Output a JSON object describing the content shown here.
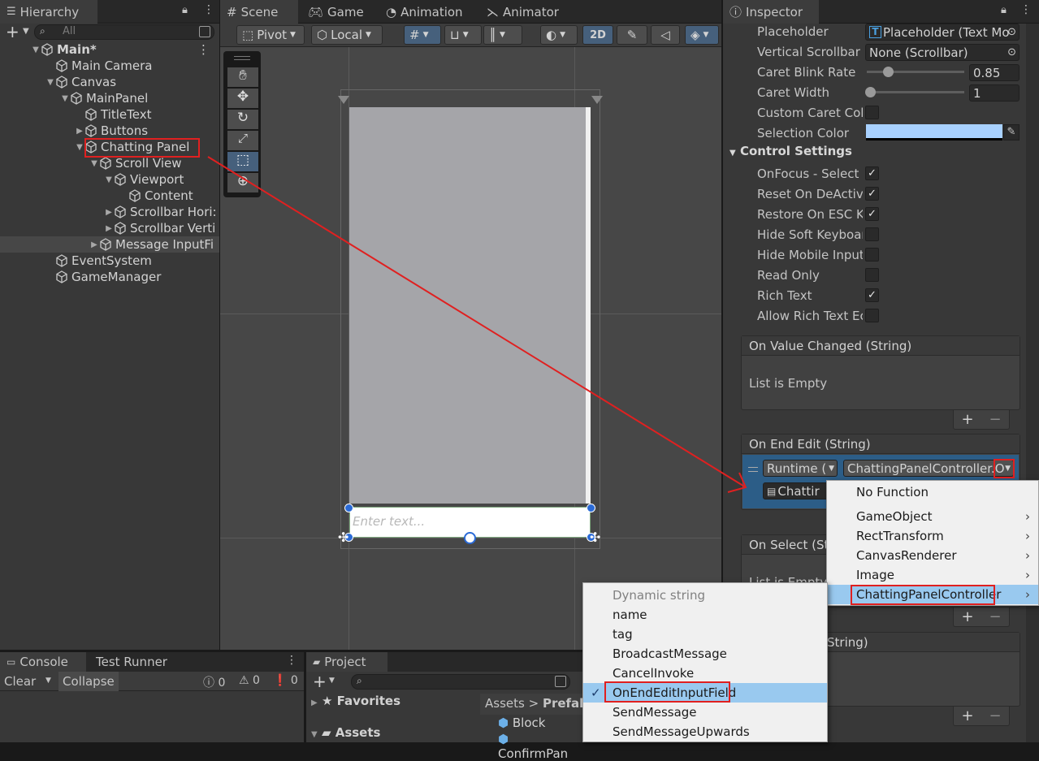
{
  "hierarchy": {
    "tab": "Hierarchy",
    "search_placeholder": "All",
    "items": [
      {
        "label": "Main*",
        "depth": 0,
        "expanded": true,
        "bold": true
      },
      {
        "label": "Main Camera",
        "depth": 1
      },
      {
        "label": "Canvas",
        "depth": 1,
        "expanded": true
      },
      {
        "label": "MainPanel",
        "depth": 2,
        "expanded": true
      },
      {
        "label": "TitleText",
        "depth": 3
      },
      {
        "label": "Buttons",
        "depth": 3,
        "collapsed": true
      },
      {
        "label": "Chatting Panel",
        "depth": 3,
        "expanded": true,
        "highlighted": true
      },
      {
        "label": "Scroll View",
        "depth": 4,
        "expanded": true
      },
      {
        "label": "Viewport",
        "depth": 5,
        "expanded": true
      },
      {
        "label": "Content",
        "depth": 6
      },
      {
        "label": "Scrollbar Hori:",
        "depth": 5,
        "collapsed": true
      },
      {
        "label": "Scrollbar Verti",
        "depth": 5,
        "collapsed": true
      },
      {
        "label": "Message InputFi",
        "depth": 4,
        "collapsed": true,
        "selected": true
      },
      {
        "label": "EventSystem",
        "depth": 1
      },
      {
        "label": "GameManager",
        "depth": 1
      }
    ]
  },
  "scene": {
    "tabs": [
      "Scene",
      "Game",
      "Animation",
      "Animator"
    ],
    "pivot": "Pivot",
    "local": "Local",
    "mode2d": "2D",
    "input_placeholder": "Enter text..."
  },
  "inspector": {
    "tab": "Inspector",
    "placeholder_label": "Placeholder",
    "placeholder_value": "Placeholder (Text Mo",
    "vscroll_label": "Vertical Scrollbar",
    "vscroll_value": "None (Scrollbar)",
    "caret_blink_label": "Caret Blink Rate",
    "caret_blink_value": "0.85",
    "caret_blink_fraction": 0.21,
    "caret_width_label": "Caret Width",
    "caret_width_value": "1",
    "caret_width_fraction": 0.0,
    "custom_caret_label": "Custom Caret Colo",
    "selection_color_label": "Selection Color",
    "selection_color": "#a8d1ff",
    "control_settings": "Control Settings",
    "toggles": [
      {
        "label": "OnFocus - Select",
        "checked": true
      },
      {
        "label": "Reset On DeActiva",
        "checked": true
      },
      {
        "label": "Restore On ESC Ke",
        "checked": true
      },
      {
        "label": "Hide Soft Keyboar",
        "checked": false
      },
      {
        "label": "Hide Mobile Input",
        "checked": false
      },
      {
        "label": "Read Only",
        "checked": false
      },
      {
        "label": "Rich Text",
        "checked": true
      },
      {
        "label": "Allow Rich Text Ec",
        "checked": false
      }
    ],
    "on_value_changed": "On Value Changed (String)",
    "list_empty": "List is Empty",
    "on_end_edit": "On End Edit (String)",
    "runtime": "Runtime (",
    "function_field": "ChattingPanelController.O",
    "object_field": "Chattir",
    "on_select": "On Select (St",
    "list_empty_partial": "List is Empty",
    "another_event": "String)"
  },
  "component_menu": [
    {
      "label": "No Function"
    },
    {
      "label": "GameObject",
      "sub": true
    },
    {
      "label": "RectTransform",
      "sub": true
    },
    {
      "label": "CanvasRenderer",
      "sub": true
    },
    {
      "label": "Image",
      "sub": true
    },
    {
      "label": "ChattingPanelController",
      "sub": true,
      "active": true
    }
  ],
  "method_menu": {
    "header": "Dynamic string",
    "items": [
      {
        "label": "name"
      },
      {
        "label": "tag"
      },
      {
        "label": "BroadcastMessage"
      },
      {
        "label": "CancelInvoke"
      },
      {
        "label": "OnEndEditInputField",
        "checked": true
      },
      {
        "label": "SendMessage"
      },
      {
        "label": "SendMessageUpwards"
      }
    ]
  },
  "console": {
    "tabs": [
      "Console",
      "Test Runner"
    ],
    "clear": "Clear",
    "collapse": "Collapse",
    "counts": [
      "0",
      "0",
      "0"
    ]
  },
  "project": {
    "tab": "Project",
    "favorites": "Favorites",
    "assets": "Assets",
    "breadcrumb": [
      "Assets",
      "Prefab"
    ],
    "files": [
      "Block",
      "ConfirmPan"
    ]
  },
  "colors": {
    "highlight": "#e02020",
    "selection_blue": "#2c5d87",
    "menu_hover": "#99c9ef"
  }
}
